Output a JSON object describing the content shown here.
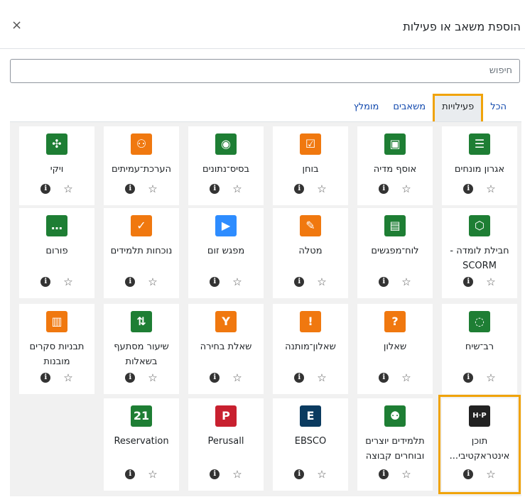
{
  "dialog": {
    "title": "הוספת משאב או פעילות",
    "close_glyph": "×"
  },
  "search": {
    "placeholder": "חיפוש"
  },
  "tabs": [
    {
      "label": "הכל"
    },
    {
      "label": "פעילויות"
    },
    {
      "label": "משאבים"
    },
    {
      "label": "מומלץ"
    }
  ],
  "cards": [
    {
      "name": "אגרון מונחים",
      "icon": "list-icon",
      "glyph": "☰",
      "color": "#1e7e34"
    },
    {
      "name": "אוסף מדיה",
      "icon": "media-icon",
      "glyph": "▣",
      "color": "#1e7e34"
    },
    {
      "name": "בוחן",
      "icon": "checklist-icon",
      "glyph": "☑",
      "color": "#f0780f"
    },
    {
      "name": "בסיס־נתונים",
      "icon": "database-icon",
      "glyph": "◉",
      "color": "#1e7e34"
    },
    {
      "name": "הערכת־עמיתים",
      "icon": "peers-icon",
      "glyph": "⚇",
      "color": "#f0780f"
    },
    {
      "name": "ויקי",
      "icon": "network-icon",
      "glyph": "✣",
      "color": "#1e7e34"
    },
    {
      "name": "חבילת לומדה - SCORM",
      "icon": "package-icon",
      "glyph": "⬡",
      "color": "#1e7e34"
    },
    {
      "name": "לוח־מפגשים",
      "icon": "calendar-icon",
      "glyph": "▤",
      "color": "#1e7e34"
    },
    {
      "name": "מטלה",
      "icon": "edit-icon",
      "glyph": "✎",
      "color": "#f0780f"
    },
    {
      "name": "מפגש זום",
      "icon": "zoom-icon",
      "glyph": "▶",
      "color": "#2d8cff"
    },
    {
      "name": "נוכחות תלמידים",
      "icon": "user-check-icon",
      "glyph": "✓",
      "color": "#f0780f"
    },
    {
      "name": "פורום",
      "icon": "chat-icon",
      "glyph": "…",
      "color": "#1e7e34"
    },
    {
      "name": "רב־שיח",
      "icon": "discussion-icon",
      "glyph": "◌",
      "color": "#1e7e34"
    },
    {
      "name": "שאלון",
      "icon": "question-icon",
      "glyph": "?",
      "color": "#f0780f"
    },
    {
      "name": "שאלון־מותנה",
      "icon": "alert-icon",
      "glyph": "!",
      "color": "#f0780f"
    },
    {
      "name": "שאלת בחירה",
      "icon": "fork-icon",
      "glyph": "Y",
      "color": "#f0780f"
    },
    {
      "name": "שיעור מסתעף בשאלות",
      "icon": "signpost-icon",
      "glyph": "⇅",
      "color": "#1e7e34"
    },
    {
      "name": "תבניות סקרים מובנות",
      "icon": "bar-chart-icon",
      "glyph": "▥",
      "color": "#f0780f"
    },
    {
      "name": "תוכן אינטראקטיבי...",
      "icon": "h5p-icon",
      "glyph": "H·P",
      "color": "#222222"
    },
    {
      "name": "תלמידים יוצרים ובוחרים קבוצה",
      "icon": "group-icon",
      "glyph": "⚉",
      "color": "#1e7e34"
    },
    {
      "name": "EBSCO",
      "icon": "ebsco-icon",
      "glyph": "E",
      "color": "#0b3b60"
    },
    {
      "name": "Perusall",
      "icon": "perusall-icon",
      "glyph": "P",
      "color": "#c8202f"
    },
    {
      "name": "Reservation",
      "icon": "calendar-21-icon",
      "glyph": "21",
      "color": "#1e7e34"
    }
  ],
  "card_actions": {
    "info_glyph": "i",
    "star_glyph": "☆"
  }
}
